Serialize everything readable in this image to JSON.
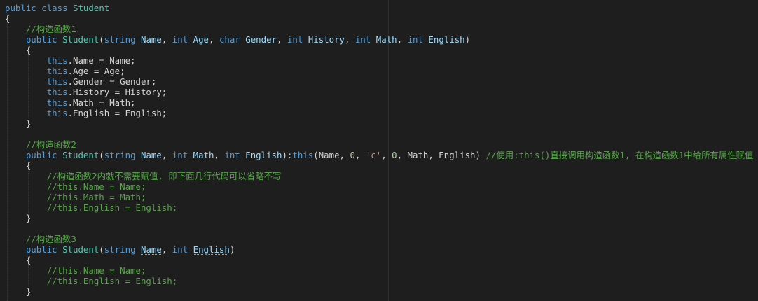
{
  "editor": {
    "language": "C#",
    "lines": [
      [
        [
          "kw",
          "public"
        ],
        [
          "pun",
          " "
        ],
        [
          "kw",
          "class"
        ],
        [
          "pun",
          " "
        ],
        [
          "cls",
          "Student"
        ]
      ],
      [
        [
          "pun",
          "{"
        ]
      ],
      [
        [
          "pun",
          "    "
        ],
        [
          "cmt",
          "//构造函数1"
        ]
      ],
      [
        [
          "pun",
          "    "
        ],
        [
          "kw",
          "public"
        ],
        [
          "pun",
          " "
        ],
        [
          "cls",
          "Student"
        ],
        [
          "pun",
          "("
        ],
        [
          "kw",
          "string"
        ],
        [
          "pun",
          " "
        ],
        [
          "prm",
          "Name"
        ],
        [
          "pun",
          ", "
        ],
        [
          "kw",
          "int"
        ],
        [
          "pun",
          " "
        ],
        [
          "prm",
          "Age"
        ],
        [
          "pun",
          ", "
        ],
        [
          "kw",
          "char"
        ],
        [
          "pun",
          " "
        ],
        [
          "prm",
          "Gender"
        ],
        [
          "pun",
          ", "
        ],
        [
          "kw",
          "int"
        ],
        [
          "pun",
          " "
        ],
        [
          "prm",
          "History"
        ],
        [
          "pun",
          ", "
        ],
        [
          "kw",
          "int"
        ],
        [
          "pun",
          " "
        ],
        [
          "prm",
          "Math"
        ],
        [
          "pun",
          ", "
        ],
        [
          "kw",
          "int"
        ],
        [
          "pun",
          " "
        ],
        [
          "prm",
          "English"
        ],
        [
          "pun",
          ")"
        ]
      ],
      [
        [
          "pun",
          "    {"
        ]
      ],
      [
        [
          "pun",
          "        "
        ],
        [
          "kw",
          "this"
        ],
        [
          "pun",
          ".Name = Name;"
        ]
      ],
      [
        [
          "pun",
          "        "
        ],
        [
          "kw",
          "this"
        ],
        [
          "pun",
          ".Age = Age;"
        ]
      ],
      [
        [
          "pun",
          "        "
        ],
        [
          "kw",
          "this"
        ],
        [
          "pun",
          ".Gender = Gender;"
        ]
      ],
      [
        [
          "pun",
          "        "
        ],
        [
          "kw",
          "this"
        ],
        [
          "pun",
          ".History = History;"
        ]
      ],
      [
        [
          "pun",
          "        "
        ],
        [
          "kw",
          "this"
        ],
        [
          "pun",
          ".Math = Math;"
        ]
      ],
      [
        [
          "pun",
          "        "
        ],
        [
          "kw",
          "this"
        ],
        [
          "pun",
          ".English = English;"
        ]
      ],
      [
        [
          "pun",
          "    }"
        ]
      ],
      [
        [
          "pun",
          ""
        ]
      ],
      [
        [
          "pun",
          "    "
        ],
        [
          "cmt",
          "//构造函数2"
        ]
      ],
      [
        [
          "pun",
          "    "
        ],
        [
          "kw",
          "public"
        ],
        [
          "pun",
          " "
        ],
        [
          "cls",
          "Student"
        ],
        [
          "pun",
          "("
        ],
        [
          "kw",
          "string"
        ],
        [
          "pun",
          " "
        ],
        [
          "prm",
          "Name"
        ],
        [
          "pun",
          ", "
        ],
        [
          "kw",
          "int"
        ],
        [
          "pun",
          " "
        ],
        [
          "prm",
          "Math"
        ],
        [
          "pun",
          ", "
        ],
        [
          "kw",
          "int"
        ],
        [
          "pun",
          " "
        ],
        [
          "prm",
          "English"
        ],
        [
          "pun",
          "):"
        ],
        [
          "kw",
          "this"
        ],
        [
          "pun",
          "(Name, "
        ],
        [
          "num",
          "0"
        ],
        [
          "pun",
          ", "
        ],
        [
          "str",
          "'c'"
        ],
        [
          "pun",
          ", "
        ],
        [
          "num",
          "0"
        ],
        [
          "pun",
          ", Math, English) "
        ],
        [
          "cmt",
          "//使用:this()直接调用构造函数1, 在构造函数1中给所有属性赋值"
        ]
      ],
      [
        [
          "pun",
          "    {"
        ]
      ],
      [
        [
          "pun",
          "        "
        ],
        [
          "cmt",
          "//构造函数2内就不需要赋值, 即下面几行代码可以省略不写"
        ]
      ],
      [
        [
          "pun",
          "        "
        ],
        [
          "cmt",
          "//this.Name = Name;"
        ]
      ],
      [
        [
          "pun",
          "        "
        ],
        [
          "cmt",
          "//this.Math = Math;"
        ]
      ],
      [
        [
          "pun",
          "        "
        ],
        [
          "cmt",
          "//this.English = English;"
        ]
      ],
      [
        [
          "pun",
          "    }"
        ]
      ],
      [
        [
          "pun",
          ""
        ]
      ],
      [
        [
          "pun",
          "    "
        ],
        [
          "cmt",
          "//构造函数3"
        ]
      ],
      [
        [
          "pun",
          "    "
        ],
        [
          "kw",
          "public"
        ],
        [
          "pun",
          " "
        ],
        [
          "cls",
          "Student"
        ],
        [
          "pun",
          "("
        ],
        [
          "kw",
          "string"
        ],
        [
          "pun",
          " "
        ],
        [
          "prm squig",
          "Name"
        ],
        [
          "pun",
          ", "
        ],
        [
          "kw",
          "int"
        ],
        [
          "pun",
          " "
        ],
        [
          "prm squig",
          "English"
        ],
        [
          "pun",
          ")"
        ]
      ],
      [
        [
          "pun",
          "    {"
        ]
      ],
      [
        [
          "pun",
          "        "
        ],
        [
          "cmt",
          "//this.Name = Name;"
        ]
      ],
      [
        [
          "pun",
          "        "
        ],
        [
          "cmt",
          "//this.English = English;"
        ]
      ],
      [
        [
          "pun",
          "    }"
        ]
      ]
    ]
  }
}
